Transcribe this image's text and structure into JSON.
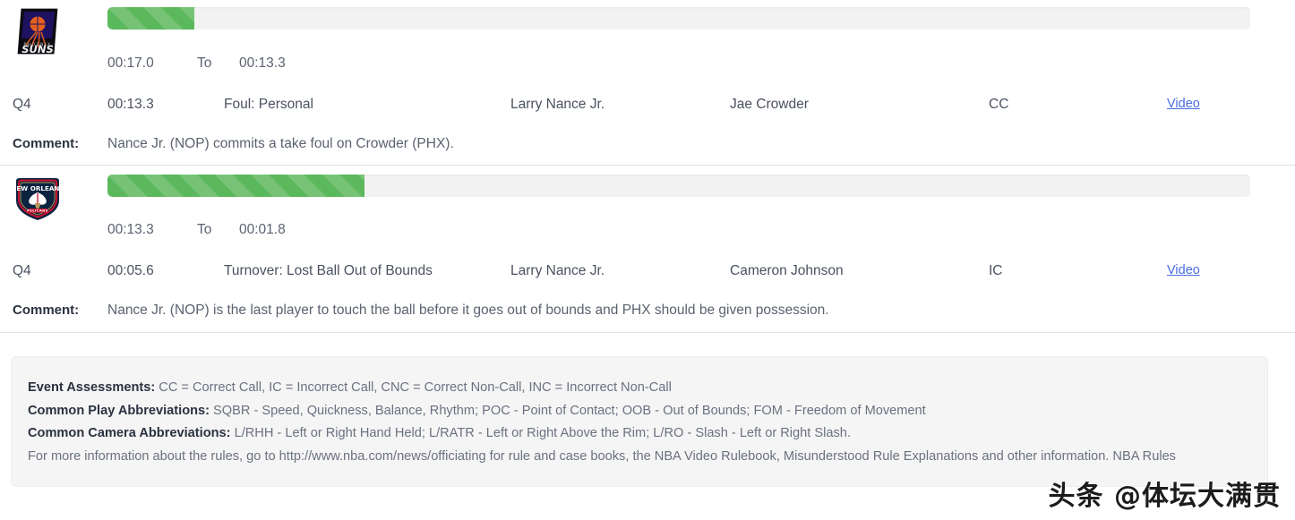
{
  "events": [
    {
      "team_logo": "phoenix-suns-logo",
      "team_name": "Phoenix Suns",
      "progress_percent": 7.6,
      "range": {
        "start": "00:17.0",
        "to_label": "To",
        "end": "00:13.3"
      },
      "period": "Q4",
      "time": "00:13.3",
      "call_type": "Foul: Personal",
      "committing_player": "Larry Nance Jr.",
      "disadvantaged_player": "Jae Crowder",
      "assessment": "CC",
      "video_label": "Video",
      "comment_label": "Comment:",
      "comment": "Nance Jr. (NOP) commits a take foul on Crowder (PHX)."
    },
    {
      "team_logo": "new-orleans-pelicans-logo",
      "team_name": "New Orleans Pelicans",
      "progress_percent": 22.5,
      "range": {
        "start": "00:13.3",
        "to_label": "To",
        "end": "00:01.8"
      },
      "period": "Q4",
      "time": "00:05.6",
      "call_type": "Turnover: Lost Ball Out of Bounds",
      "committing_player": "Larry Nance Jr.",
      "disadvantaged_player": "Cameron Johnson",
      "assessment": "IC",
      "video_label": "Video",
      "comment_label": "Comment:",
      "comment": "Nance Jr. (NOP) is the last player to touch the ball before it goes out of bounds and PHX should be given possession."
    }
  ],
  "legend": {
    "event_assessments_label": "Event Assessments:",
    "event_assessments_text": " CC = Correct Call, IC = Incorrect Call, CNC = Correct Non-Call, INC = Incorrect Non-Call",
    "play_abbrev_label": "Common Play Abbreviations:",
    "play_abbrev_text": " SQBR - Speed, Quickness, Balance, Rhythm; POC - Point of Contact; OOB - Out of Bounds; FOM - Freedom of Movement",
    "camera_abbrev_label": "Common Camera Abbreviations:",
    "camera_abbrev_text": " L/RHH - Left or Right Hand Held; L/RATR - Left or Right Above the Rim; L/RO - Slash - Left or Right Slash.",
    "more_info": "For more information about the rules, go to http://www.nba.com/news/officiating for rule and case books, the NBA Video Rulebook, Misunderstood Rule Explanations and other information. NBA Rules"
  },
  "watermark": {
    "text": "头条 @体坛大满贯"
  },
  "colors": {
    "progress_fill": "#5cb85c",
    "progress_track": "#f2f2f2",
    "link": "#4a6ee0",
    "legend_bg": "#f5f5f5",
    "text": "#5b6270"
  }
}
